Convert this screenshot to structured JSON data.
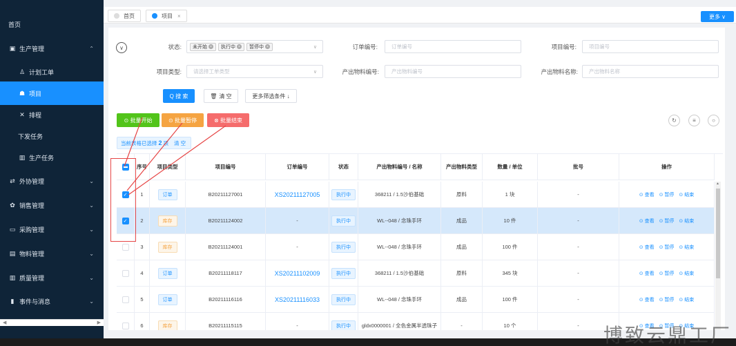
{
  "sidebar": {
    "items": [
      {
        "label": "首页",
        "icon": "",
        "chevron": "",
        "active": false
      },
      {
        "label": "生产管理",
        "icon": "document-icon",
        "chevron": "^",
        "active": false
      },
      {
        "label": "计划工单",
        "icon": "users-icon",
        "chevron": "",
        "active": false
      },
      {
        "label": "项目",
        "icon": "graduation-cap-icon",
        "chevron": "",
        "active": true
      },
      {
        "label": "排程",
        "icon": "tools-icon",
        "chevron": "",
        "active": false
      },
      {
        "label": "下发任务",
        "icon": "",
        "chevron": "",
        "active": false
      },
      {
        "label": "生产任务",
        "icon": "chart-box-icon",
        "chevron": "",
        "active": false
      },
      {
        "label": "外协管理",
        "icon": "swap-icon",
        "chevron": "v",
        "active": false
      },
      {
        "label": "销售管理",
        "icon": "cluster-icon",
        "chevron": "v",
        "active": false
      },
      {
        "label": "采购管理",
        "icon": "bag-icon",
        "chevron": "v",
        "active": false
      },
      {
        "label": "物料管理",
        "icon": "box-icon",
        "chevron": "v",
        "active": false
      },
      {
        "label": "质量管理",
        "icon": "chart-box-icon",
        "chevron": "v",
        "active": false
      },
      {
        "label": "事件与消息",
        "icon": "bar-chart-icon",
        "chevron": "v",
        "active": false
      }
    ]
  },
  "tabs": [
    {
      "label": "首页",
      "closable": false
    },
    {
      "label": "项目",
      "closable": true,
      "close": "×"
    }
  ],
  "more_label": "更多 ∨",
  "filters": {
    "status_label": "状态:",
    "status_tags": [
      "未开始",
      "执行中",
      "暂停中"
    ],
    "order_no_label": "订单编号:",
    "order_no_placeholder": "订单编号",
    "project_no_label": "项目编号:",
    "project_no_placeholder": "项目编号",
    "project_type_label": "项目类型:",
    "project_type_placeholder": "请选择工单类型",
    "output_no_label": "产出物料编号:",
    "output_no_placeholder": "产出物料编号",
    "output_name_label": "产出物料名称:",
    "output_name_placeholder": "产出物料名称"
  },
  "actions": {
    "search": "Q 搜 索",
    "clear": "清 空",
    "more_filters": "更多筛选条件 ↓",
    "batch_start": "⊙ 批量开始",
    "batch_pause": "⊙ 批量暂停",
    "batch_end": "⊗ 批量结束"
  },
  "selection": {
    "prefix": "当前表格已选择",
    "count": "2",
    "suffix": "项",
    "clear": "清 空"
  },
  "table": {
    "headers": [
      "序号",
      "项目类型",
      "项目编号",
      "订单编号",
      "状态",
      "产出物料编号 / 名称",
      "产出物料类型",
      "数量 / 单位",
      "批号",
      "操作"
    ],
    "ops": [
      "⊙ 查看",
      "⊙ 暂停",
      "⊙ 结束"
    ],
    "rows": [
      {
        "no": "1",
        "type": "订单",
        "type_color": "blue",
        "project_no": "B20211127001",
        "order_no": "XS20211127005",
        "status": "执行中",
        "material": "368211 / 1.5沙伯基础",
        "mat_type": "原料",
        "qty": "1 块",
        "batch": "-",
        "checked": true,
        "selected": false
      },
      {
        "no": "2",
        "type": "库存",
        "type_color": "orange",
        "project_no": "B20211124002",
        "order_no": "-",
        "status": "执行中",
        "material": "WL--048 / 念珠手环",
        "mat_type": "成品",
        "qty": "10 件",
        "batch": "-",
        "checked": true,
        "selected": true
      },
      {
        "no": "3",
        "type": "库存",
        "type_color": "orange",
        "project_no": "B20211124001",
        "order_no": "-",
        "status": "执行中",
        "material": "WL--048 / 念珠手环",
        "mat_type": "成品",
        "qty": "100 件",
        "batch": "-",
        "checked": false,
        "selected": false
      },
      {
        "no": "4",
        "type": "订单",
        "type_color": "blue",
        "project_no": "B20211118117",
        "order_no": "XS20211102009",
        "status": "执行中",
        "material": "368211 / 1.5沙伯基础",
        "mat_type": "原料",
        "qty": "345 块",
        "batch": "-",
        "checked": false,
        "selected": false
      },
      {
        "no": "5",
        "type": "订单",
        "type_color": "blue",
        "project_no": "B20211116116",
        "order_no": "XS20211116033",
        "status": "执行中",
        "material": "WL--048 / 念珠手环",
        "mat_type": "成品",
        "qty": "100 件",
        "batch": "-",
        "checked": false,
        "selected": false
      },
      {
        "no": "6",
        "type": "库存",
        "type_color": "orange",
        "project_no": "B20211115115",
        "order_no": "-",
        "status": "执行中",
        "material": "gldx0000001 / 全色金属半透珠子",
        "mat_type": "-",
        "qty": "10 个",
        "batch": "-",
        "checked": false,
        "selected": false
      }
    ]
  },
  "watermark": "博致云鼎工厂"
}
